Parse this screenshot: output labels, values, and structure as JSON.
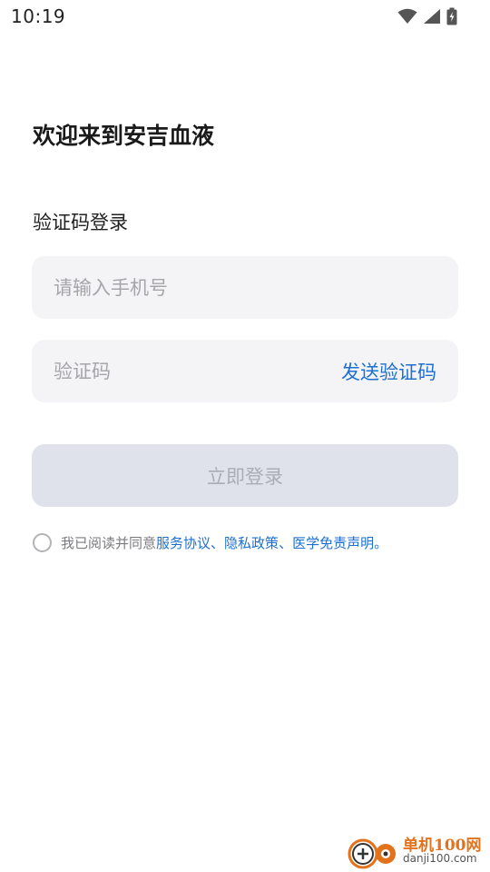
{
  "status_bar": {
    "time": "10:19",
    "icons": [
      "wifi-icon",
      "cellular-signal-icon",
      "battery-charging-icon"
    ]
  },
  "welcome": {
    "title": "欢迎来到安吉血液"
  },
  "login": {
    "subtitle": "验证码登录",
    "phone_placeholder": "请输入手机号",
    "phone_value": "",
    "code_placeholder": "验证码",
    "code_value": "",
    "send_code_label": "发送验证码",
    "submit_label": "立即登录",
    "submit_enabled": false
  },
  "agreement": {
    "checked": false,
    "prefix": "我已阅读并同意",
    "links": [
      {
        "label": "服务协议"
      },
      {
        "label": "隐私政策"
      },
      {
        "label": "医学免责声明"
      }
    ],
    "separator": "、",
    "suffix": "。"
  },
  "watermark": {
    "title": "单机100网",
    "url": "danji100.com"
  },
  "colors": {
    "accent": "#1f6fd0",
    "field_bg": "#f4f4f6",
    "button_disabled_bg": "#dfe2ea",
    "button_disabled_text": "#a9adb8",
    "placeholder": "#a6a6aa",
    "watermark_orange": "#e3721c"
  }
}
